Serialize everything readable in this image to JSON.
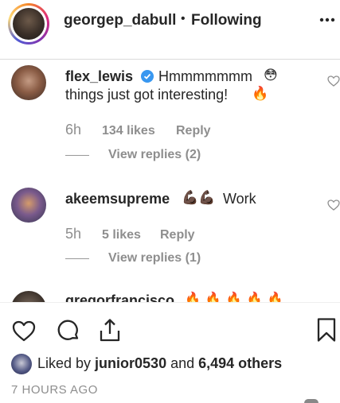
{
  "post_header": {
    "username": "georgep_dabull",
    "separator": "•",
    "follow_status": "Following",
    "more_icon": "more-horizontal-icon"
  },
  "comments": [
    {
      "username": "flex_lewis",
      "verified": true,
      "text_line1": "Hmmmmmmm",
      "text_line2": "things just got interesting!",
      "emoji_after_line1": "😳",
      "emoji_after_line2": "🔥",
      "time": "6h",
      "likes": "134 likes",
      "reply": "Reply",
      "view_replies": "View replies (2)"
    },
    {
      "username": "akeemsupreme",
      "emoji_prefix": "💪🏿💪🏿",
      "text": "Work",
      "time": "5h",
      "likes": "5 likes",
      "reply": "Reply",
      "view_replies": "View replies (1)"
    }
  ],
  "partial_comment": {
    "username": "gregorfrancisco",
    "emoji": "🔥🔥🔥🔥🔥"
  },
  "action_bar": {
    "icons": [
      "heart-icon",
      "comment-icon",
      "share-icon",
      "bookmark-icon"
    ]
  },
  "likes_summary": {
    "prefix": "Liked by ",
    "user": "junior0530",
    "middle": " and ",
    "count": "6,494 others"
  },
  "timestamp": "7 HOURS AGO",
  "colors": {
    "text": "#262626",
    "secondary": "#8e8e8e",
    "verified": "#3897f0"
  }
}
